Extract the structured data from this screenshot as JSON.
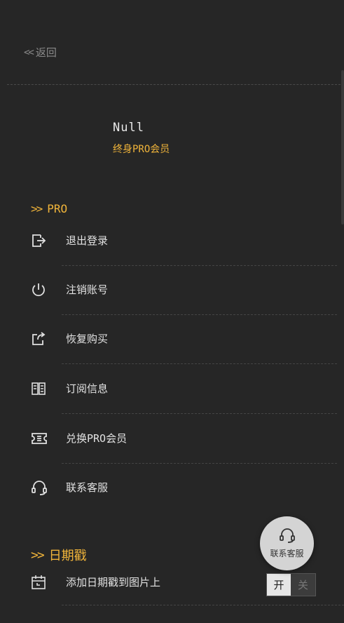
{
  "nav": {
    "back_label": "返回"
  },
  "user": {
    "name": "Null",
    "tier": "终身PRO会员"
  },
  "sections": {
    "pro": {
      "title": "PRO"
    },
    "date_stamp": {
      "title": "日期戳"
    }
  },
  "menu": {
    "items": [
      {
        "label": "退出登录",
        "icon": "logout-icon"
      },
      {
        "label": "注销账号",
        "icon": "power-icon"
      },
      {
        "label": "恢复购买",
        "icon": "restore-icon"
      },
      {
        "label": "订阅信息",
        "icon": "subscription-icon"
      },
      {
        "label": "兑换PRO会员",
        "icon": "ticket-icon"
      },
      {
        "label": "联系客服",
        "icon": "headset-icon"
      }
    ]
  },
  "date_stamp": {
    "label": "添加日期戳到图片上",
    "toggle_on": "开",
    "toggle_off": "关"
  },
  "support_fab": {
    "label": "联系客服"
  },
  "colors": {
    "background": "#262626",
    "accent": "#f0b43a",
    "fab": "#d4d4d4"
  }
}
